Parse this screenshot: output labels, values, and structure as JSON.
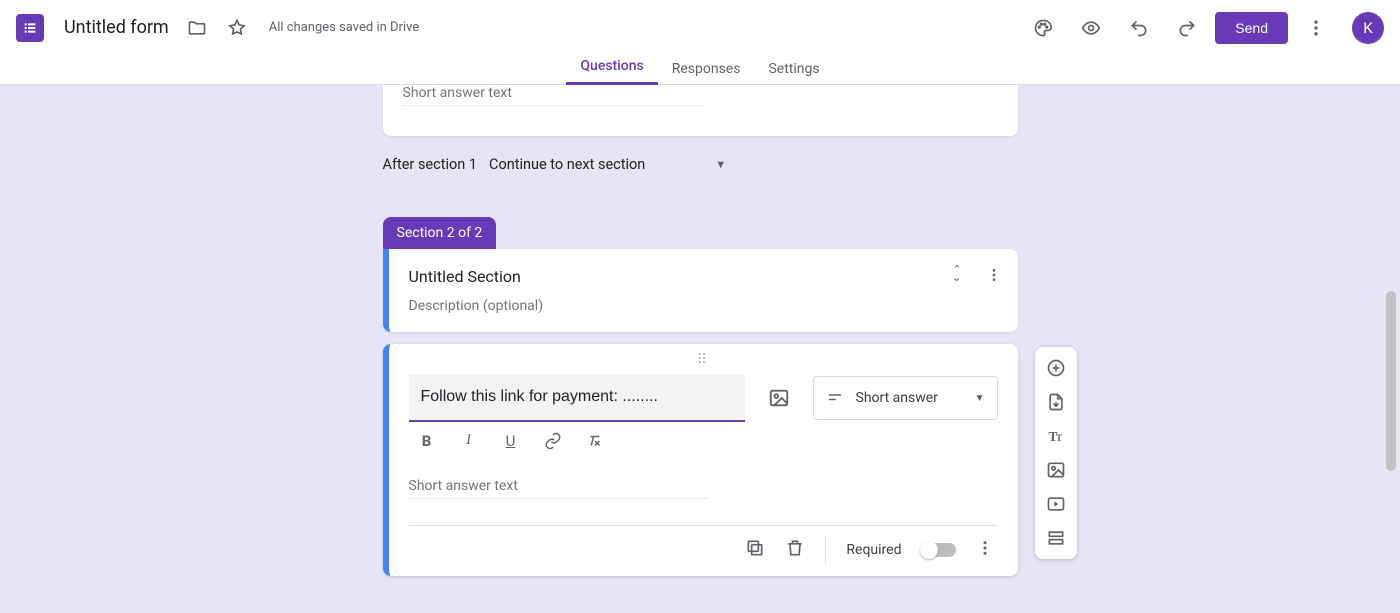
{
  "header": {
    "title": "Untitled form",
    "save_status": "All changes saved in Drive",
    "send_label": "Send",
    "avatar_initial": "K"
  },
  "tabs": {
    "questions": "Questions",
    "responses": "Responses",
    "settings": "Settings"
  },
  "prev_question": {
    "short_answer_placeholder": "Short answer text"
  },
  "after_section": {
    "label": "After section 1",
    "action": "Continue to next section"
  },
  "section": {
    "badge": "Section 2 of 2",
    "title": "Untitled Section",
    "description_placeholder": "Description (optional)"
  },
  "question": {
    "text": "Follow this link for payment: ........",
    "type_label": "Short answer",
    "short_answer_placeholder": "Short answer text",
    "required_label": "Required"
  }
}
